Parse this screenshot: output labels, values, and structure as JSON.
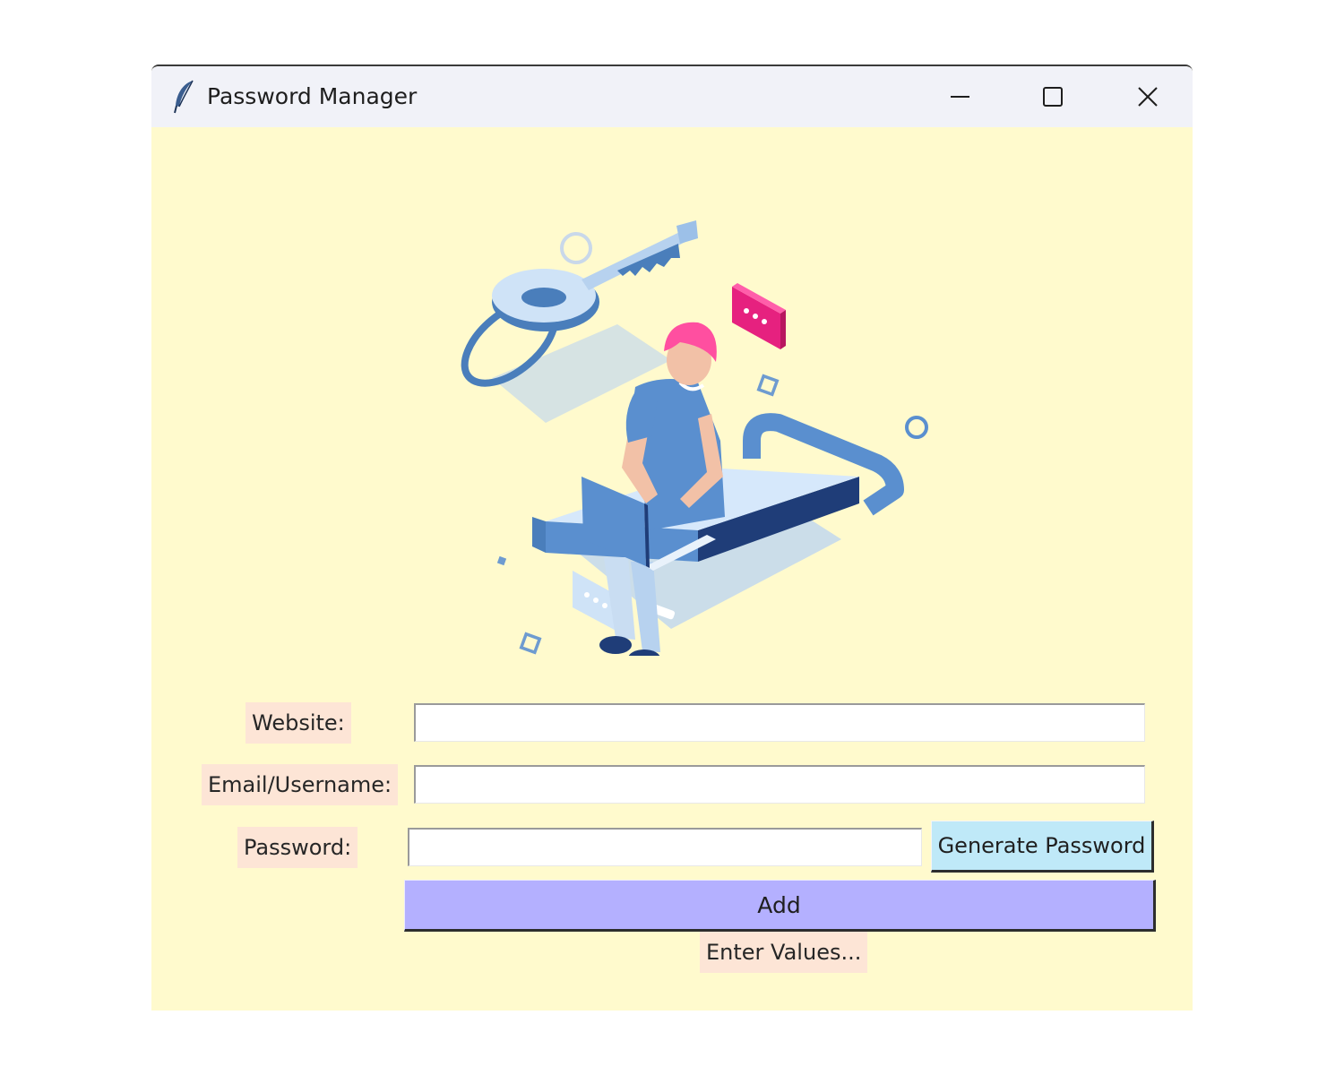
{
  "window": {
    "title": "Password Manager",
    "icon": "feather-icon",
    "controls": [
      "minimize-icon",
      "maximize-icon",
      "close-icon"
    ]
  },
  "form": {
    "website_label": "Website:",
    "website_value": "",
    "email_label": "Email/Username:",
    "email_value": "",
    "password_label": "Password:",
    "password_value": "",
    "generate_button": "Generate Password",
    "add_button": "Add",
    "status_text": "Enter Values..."
  },
  "colors": {
    "window_background": "#fffacd",
    "titlebar": "#f1f2f8",
    "label_background": "#fde5d6",
    "generate_button": "#bfe9f8",
    "add_button": "#b4b0ff"
  }
}
